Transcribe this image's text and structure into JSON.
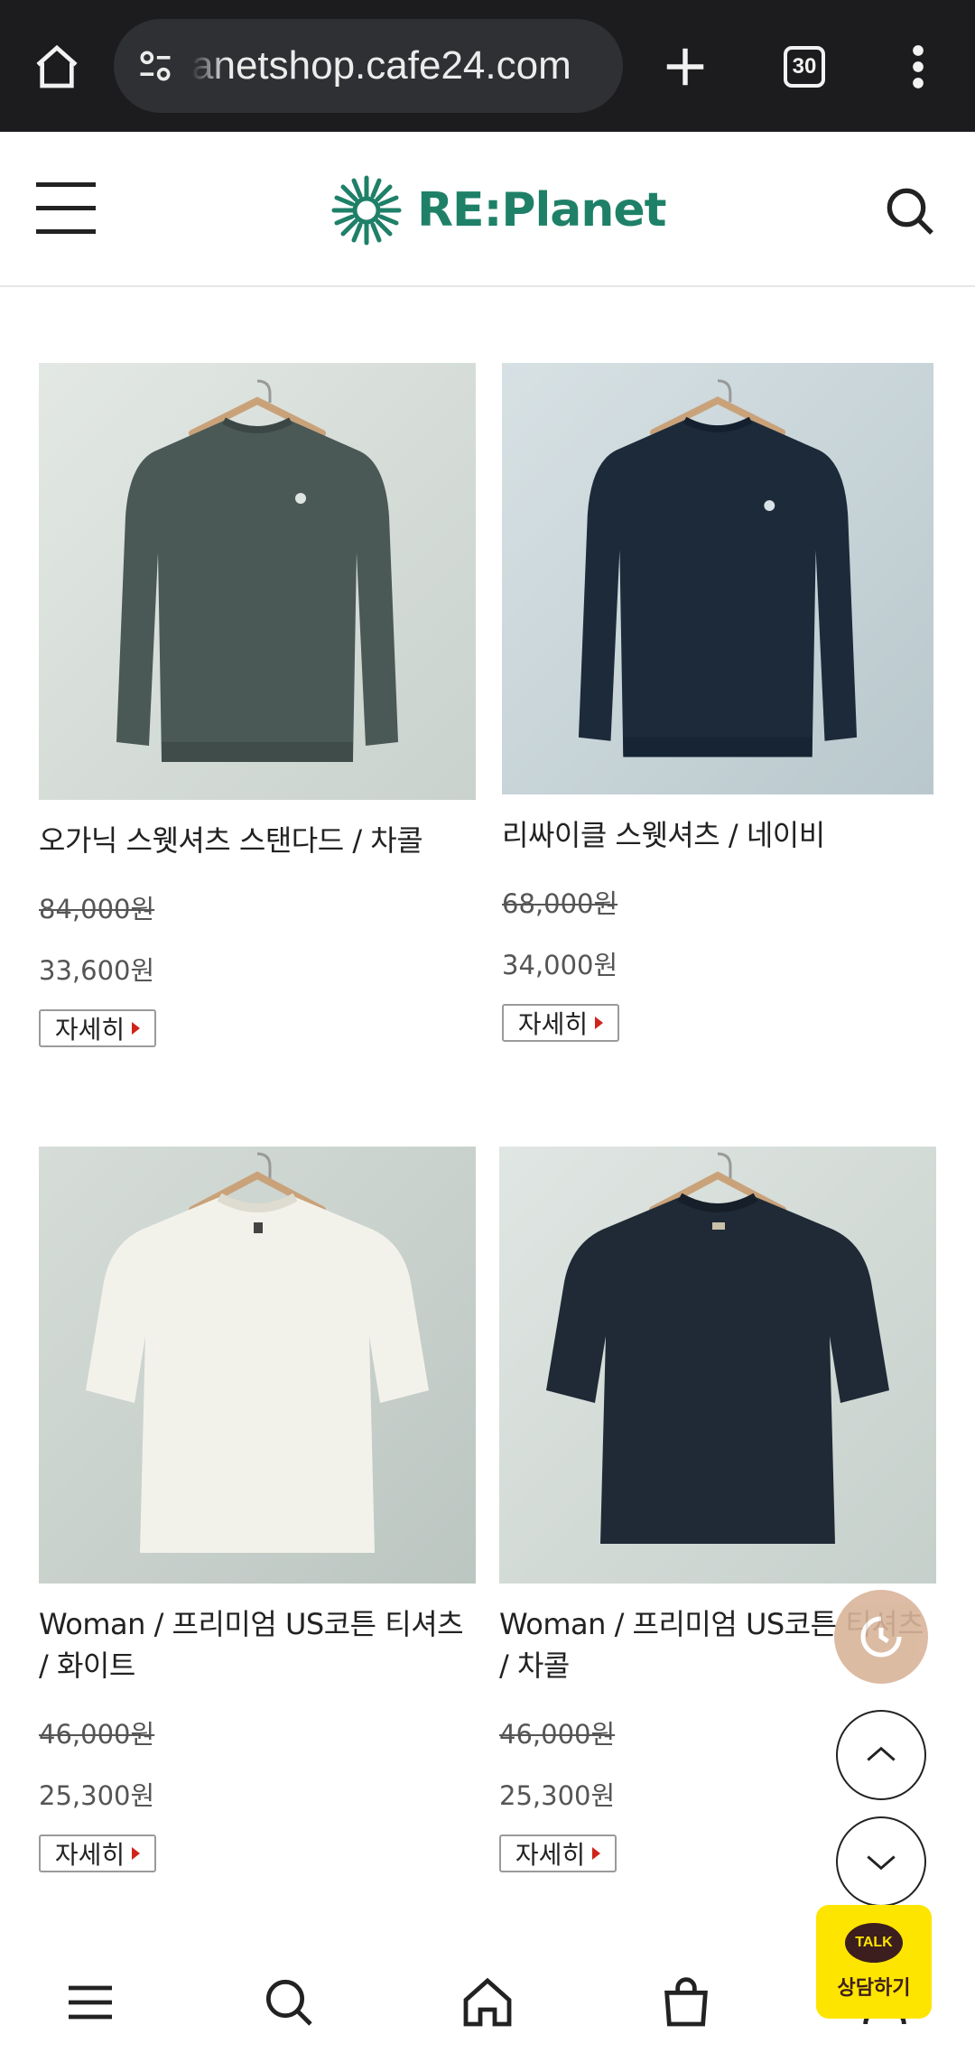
{
  "browser": {
    "url": "anetshop.cafe24.com",
    "tab_count": "30"
  },
  "header": {
    "logo_text": "RE:Planet",
    "colors": {
      "brand": "#1f8068"
    }
  },
  "products": [
    {
      "title": "오가닉 스웻셔츠 스탠다드 / 차콜",
      "old_price": "84,000원",
      "price": "33,600원",
      "detail_label": "자세히",
      "garment": "sweatshirt",
      "color": "#4a5856"
    },
    {
      "title": "리싸이클 스웻셔츠 / 네이비",
      "old_price": "68,000원",
      "price": "34,000원",
      "detail_label": "자세히",
      "garment": "sweatshirt",
      "color": "#1d2a3a"
    },
    {
      "title": "Woman / 프리미엄 US코튼 티셔츠 / 화이트",
      "old_price": "46,000원",
      "price": "25,300원",
      "detail_label": "자세히",
      "garment": "tshirt",
      "color": "#f3f2ea"
    },
    {
      "title": "Woman / 프리미엄 US코튼 티셔츠 / 차콜",
      "old_price": "46,000원",
      "price": "25,300원",
      "detail_label": "자세히",
      "garment": "tshirt",
      "color": "#1f2a36"
    }
  ],
  "floating": {
    "kakao_talk": "TALK",
    "kakao_label": "상담하기"
  },
  "bottom_nav": [
    "menu-icon",
    "search-icon",
    "home-icon",
    "cart-icon",
    "my-page-icon"
  ]
}
